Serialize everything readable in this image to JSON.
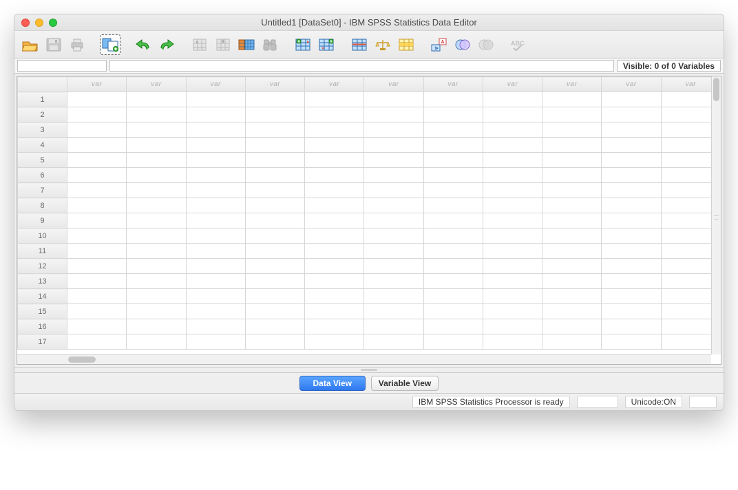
{
  "window": {
    "title": "Untitled1 [DataSet0] - IBM SPSS Statistics Data Editor"
  },
  "toolbar": {
    "icons": [
      "open",
      "save",
      "print",
      "dialog-recall",
      "undo",
      "redo",
      "goto-case",
      "goto-variable",
      "variables",
      "find",
      "insert-case",
      "insert-variable",
      "split-file",
      "weight-cases",
      "select-cases",
      "value-labels",
      "use-sets",
      "show-all",
      "spellcheck"
    ]
  },
  "visibility": {
    "text": "Visible: 0 of 0 Variables"
  },
  "grid": {
    "column_header": "var",
    "columns": 11,
    "rows": 17
  },
  "tabs": {
    "data_view": "Data View",
    "variable_view": "Variable View",
    "active": "data_view"
  },
  "status": {
    "processor": "IBM SPSS Statistics Processor is ready",
    "unicode": "Unicode:ON"
  }
}
